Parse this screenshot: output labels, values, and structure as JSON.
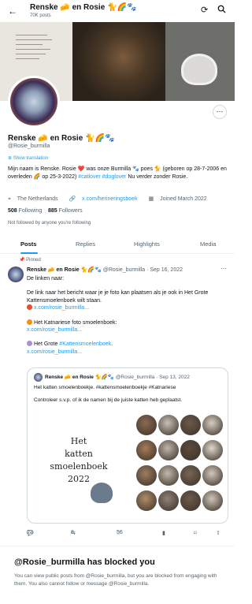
{
  "header": {
    "back_icon": "arrow-left-icon",
    "name": "Renske 🧀 en Rosie 🐈🌈🐾",
    "posts_count": "70K posts"
  },
  "profile": {
    "name": "Renske 🧀 en Rosie 🐈🌈🐾",
    "handle": "@Rosie_burmilla",
    "show_translation": "Show translation",
    "bio_1": "Mijn naam is Renske. Rosie ❤️ was onze Burmilla 🐾 poes 🐈 (geboren op 28-7-2006 en overleden 🌈 op 25-3-2022) ",
    "bio_tag1": "#catlover",
    "bio_tag2": "#doglover",
    "bio_2": " Nu verder zonder Rosie.",
    "location": "The Netherlands",
    "website": "x.com/herineringsboek",
    "joined": "Joined March 2022",
    "following_count": "508",
    "following_label": "Following",
    "followers_count": "885",
    "followers_label": "Followers",
    "not_followed": "Not followed by anyone you're following"
  },
  "tabs": {
    "posts": "Posts",
    "replies": "Replies",
    "highlights": "Highlights",
    "media": "Media"
  },
  "tweet": {
    "pinned": "Pinned",
    "name": "Renske 🧀 en Rosie 🐈🌈🐾",
    "handle_date": "@Rosie_burmilla · Sep 16, 2022",
    "line1": "De linken naar:",
    "line2": "De link naar het bericht waar je je foto kan plaatsen als je ook in Het Grote Kattensmoelenboek wilt staan.",
    "link1": "x.com/rosie_burmilla...",
    "line3": "Het Katnariese foto smoelenboek:",
    "link2": "x.com/rosie_burmilla...",
    "line4_pre": "Het Grote ",
    "line4_tag": "#Kattensmoelenboek",
    "line4_post": ".",
    "link3": "x.com/rosie_burmilla...",
    "colors": {
      "dot1": "#e0502c",
      "dot2": "#f4900c",
      "dot3": "#aa8ed6"
    }
  },
  "quote": {
    "name": "Renske 🧀 en Rosie 🐈🌈🐾",
    "handle_date": "@Rosie_burmilla · Sep 13, 2022",
    "text1": "Het katten smoelenboekje. #kattensmoelenboekje #Katnariese",
    "text2": "Controleer s.v.p. of ik de namen bij de juiste katten heb geplaatst.",
    "book_line1": "Het",
    "book_line2": "katten",
    "book_line3": "smoelenboek",
    "book_line4": "2022"
  },
  "actions": {
    "replies": "23",
    "reposts": "8",
    "likes": "56"
  },
  "blocked": {
    "title": "@Rosie_burmilla has blocked you",
    "text": "You can view public posts from @Rosie_burmilla, but you are blocked from engaging with them. You also cannot follow or message @Rosie_burmilla."
  }
}
